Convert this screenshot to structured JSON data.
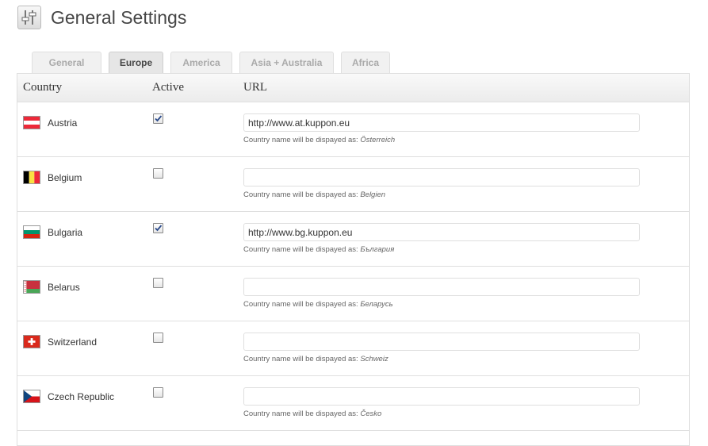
{
  "page": {
    "title": "General Settings",
    "icon": "settings-sliders-icon"
  },
  "tabs": [
    {
      "label": "General",
      "active": false
    },
    {
      "label": "Europe",
      "active": true
    },
    {
      "label": "America",
      "active": false
    },
    {
      "label": "Asia + Australia",
      "active": false
    },
    {
      "label": "Africa",
      "active": false
    }
  ],
  "table": {
    "headers": {
      "country": "Country",
      "active": "Active",
      "url": "URL"
    },
    "hint_prefix": "Country name will be dispayed as:",
    "rows": [
      {
        "country": "Austria",
        "flag": "austria-flag-icon",
        "active": true,
        "url": "http://www.at.kuppon.eu",
        "display_name": "Österreich"
      },
      {
        "country": "Belgium",
        "flag": "belgium-flag-icon",
        "active": false,
        "url": "",
        "display_name": "Belgien"
      },
      {
        "country": "Bulgaria",
        "flag": "bulgaria-flag-icon",
        "active": true,
        "url": "http://www.bg.kuppon.eu",
        "display_name": "България"
      },
      {
        "country": "Belarus",
        "flag": "belarus-flag-icon",
        "active": false,
        "url": "",
        "display_name": "Беларусь"
      },
      {
        "country": "Switzerland",
        "flag": "switzerland-flag-icon",
        "active": false,
        "url": "",
        "display_name": "Schweiz"
      },
      {
        "country": "Czech Republic",
        "flag": "czech-flag-icon",
        "active": false,
        "url": "",
        "display_name": "Česko"
      }
    ]
  }
}
